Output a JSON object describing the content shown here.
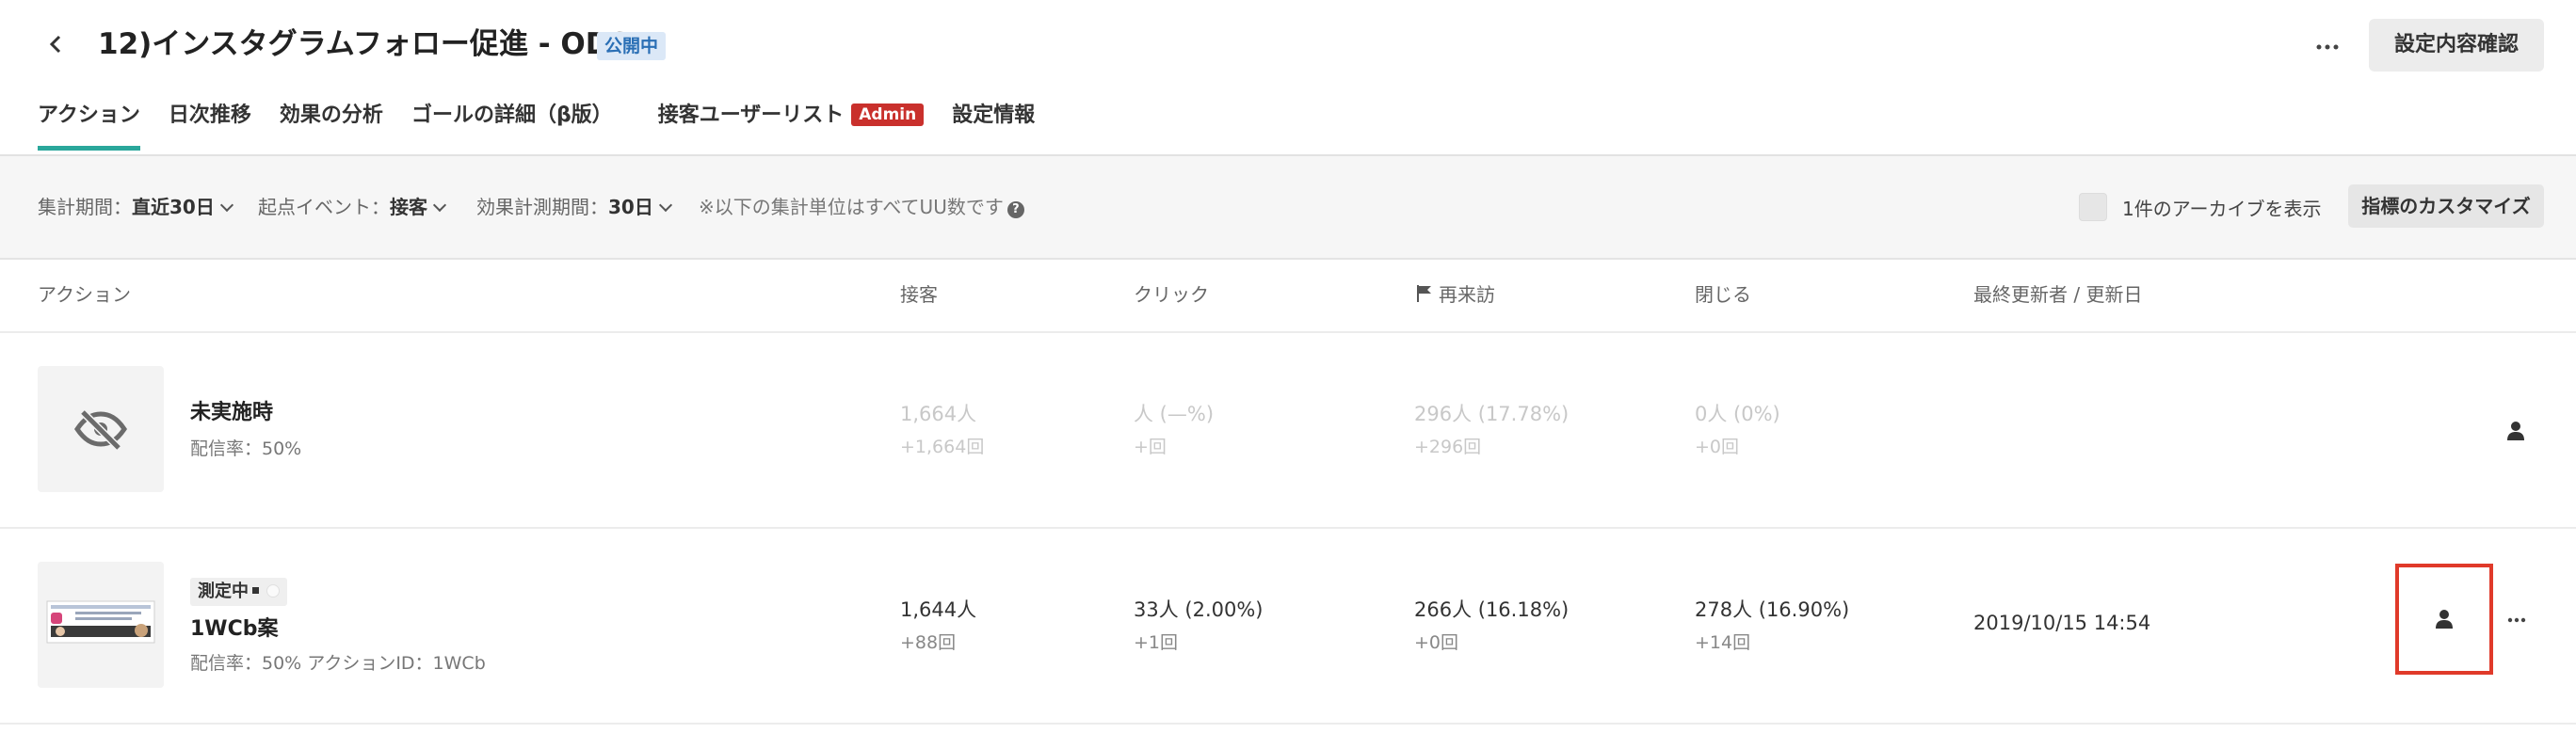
{
  "header": {
    "back_icon": "chevron-left-icon",
    "title": "12)インスタグラムフォロー促進 - ODS",
    "status_badge": "公開中",
    "more_icon": "more-horizontal-icon",
    "confirm_button": "設定内容確認"
  },
  "tabs": [
    {
      "label": "アクション",
      "active": true
    },
    {
      "label": "日次推移",
      "active": false
    },
    {
      "label": "効果の分析",
      "active": false
    },
    {
      "label": "ゴールの詳細（β版）",
      "active": false
    },
    {
      "label": "接客ユーザーリスト",
      "badge": "Admin",
      "active": false
    },
    {
      "label": "設定情報",
      "active": false
    }
  ],
  "filters": {
    "period": {
      "label": "集計期間：",
      "value": "直近30日"
    },
    "event": {
      "label": "起点イベント：",
      "value": "接客"
    },
    "measure": {
      "label": "効果計測期間：",
      "value": "30日"
    },
    "note": "※以下の集計単位はすべてUU数です",
    "archive_label": "1件のアーカイブを表示",
    "customize_button": "指標のカスタマイズ"
  },
  "columns": {
    "action": "アクション",
    "serve": "接客",
    "click": "クリック",
    "revisit": "再来訪",
    "close": "閉じる",
    "updated": "最終更新者 / 更新日"
  },
  "rows": [
    {
      "thumb_icon": "eye-off-icon",
      "name": "未実施時",
      "sub": "配信率：50%",
      "serve": {
        "main": "1,664人",
        "sub": "+1,664回"
      },
      "click": {
        "main": "人 (—%)",
        "sub": "+回"
      },
      "revisit": {
        "main": "296人 (17.78%)",
        "sub": "+296回"
      },
      "close": {
        "main": "0人 (0%)",
        "sub": "+0回"
      },
      "updated": "",
      "user_icon": "user-icon"
    },
    {
      "status": "測定中",
      "name": "1WCb案",
      "sub": "配信率：50% アクションID：1WCb",
      "serve": {
        "main": "1,644人",
        "sub": "+88回"
      },
      "click": {
        "main": "33人 (2.00%)",
        "sub": "+1回"
      },
      "revisit": {
        "main": "266人 (16.18%)",
        "sub": "+0回"
      },
      "close": {
        "main": "278人 (16.90%)",
        "sub": "+14回"
      },
      "updated": "2019/10/15 14:54",
      "user_icon": "user-icon",
      "more_icon": "more-horizontal-icon"
    }
  ],
  "colors": {
    "accent_teal": "#2aa79b",
    "admin_red": "#c9302c",
    "highlight_red": "#e03a2a",
    "badge_blue_bg": "#dbe8f7",
    "badge_blue_text": "#2a6fb5"
  }
}
